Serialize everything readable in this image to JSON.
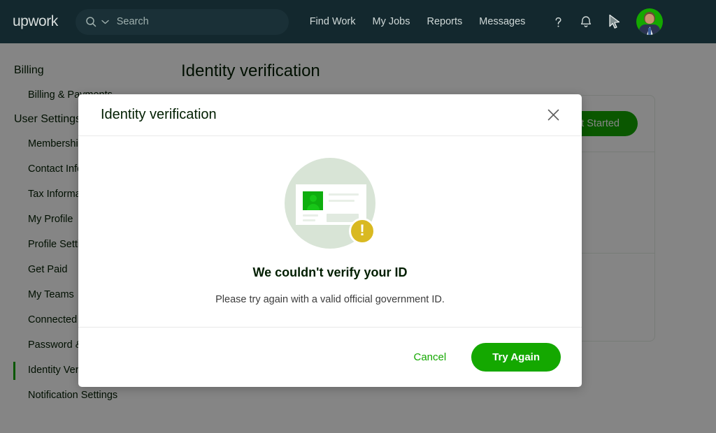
{
  "topnav": {
    "brand": "upwork",
    "search": {
      "placeholder": "Search",
      "icon": "search-icon",
      "dropdown_icon": "chevron-down-icon"
    },
    "links": [
      {
        "label": "Find Work"
      },
      {
        "label": "My Jobs"
      },
      {
        "label": "Reports"
      },
      {
        "label": "Messages"
      }
    ],
    "icons": [
      {
        "name": "help-icon",
        "glyph": "?"
      },
      {
        "name": "notifications-bell-icon"
      },
      {
        "name": "mouse-cursor-icon"
      }
    ],
    "avatar_alt": "User avatar"
  },
  "sidebar": {
    "groups": [
      {
        "label": "Billing",
        "items": [
          {
            "label": "Billing & Payments",
            "active": false
          }
        ]
      },
      {
        "label": "User Settings",
        "items": [
          {
            "label": "Membership",
            "active": false
          },
          {
            "label": "Contact Info",
            "active": false
          },
          {
            "label": "Tax Information",
            "active": false
          },
          {
            "label": "My Profile",
            "active": false
          },
          {
            "label": "Profile Settings",
            "active": false
          },
          {
            "label": "Get Paid",
            "active": false
          },
          {
            "label": "My Teams",
            "active": false
          },
          {
            "label": "Connected Services",
            "active": false
          },
          {
            "label": "Password & Security",
            "active": false
          },
          {
            "label": "Identity Verification",
            "active": true
          },
          {
            "label": "Notification Settings",
            "active": false
          }
        ]
      }
    ]
  },
  "page": {
    "title": "Identity verification",
    "get_started_label": "Get Started"
  },
  "modal": {
    "title": "Identity verification",
    "close_icon": "close-icon",
    "illustration": {
      "name": "id-card-warning-illustration",
      "warning_glyph": "!"
    },
    "heading": "We couldn't verify your ID",
    "message": "Please try again with a valid official government ID.",
    "cancel_label": "Cancel",
    "try_again_label": "Try Again"
  },
  "colors": {
    "brand_green": "#14a800",
    "nav_dark": "#13282e",
    "warning_yellow": "#d9b921",
    "overlay": "rgba(0,0,0,0.48)"
  }
}
